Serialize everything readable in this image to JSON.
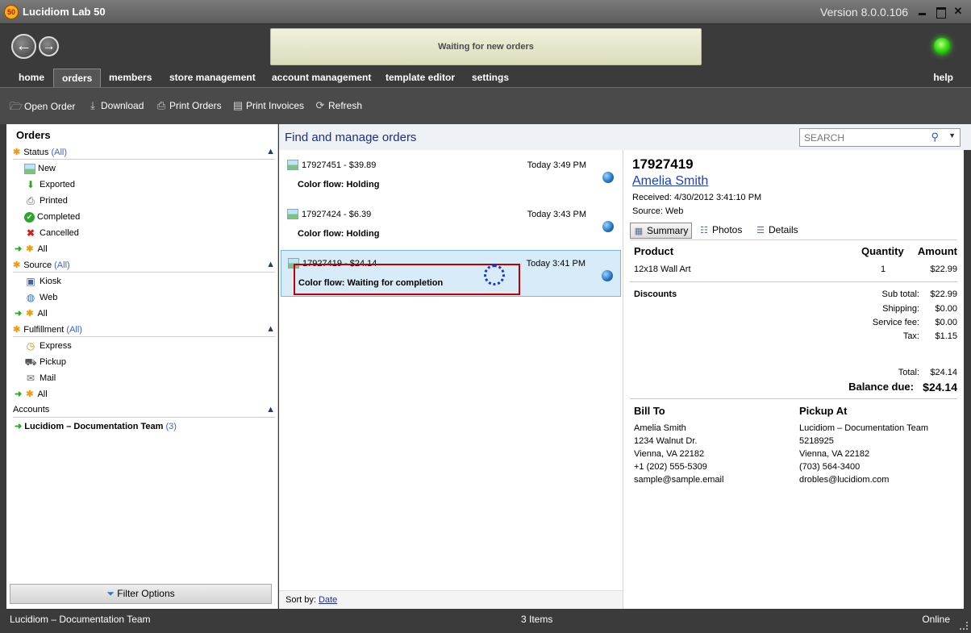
{
  "window": {
    "title": "Lucidiom Lab 50",
    "logo_text": "50",
    "version": "Version 8.0.0.106"
  },
  "header": {
    "status_message": "Waiting for new orders"
  },
  "tabs": [
    "home",
    "orders",
    "members",
    "store management",
    "account management",
    "template editor",
    "settings"
  ],
  "help_tab": "help",
  "toolbar": [
    "Open Order",
    "Download",
    "Print Orders",
    "Print Invoices",
    "Refresh"
  ],
  "left": {
    "title": "Orders",
    "status": {
      "label": "Status",
      "all": "(All)",
      "items": [
        "New",
        "Exported",
        "Printed",
        "Completed",
        "Cancelled"
      ],
      "all_item": "All"
    },
    "source": {
      "label": "Source",
      "all": "(All)",
      "items": [
        "Kiosk",
        "Web"
      ],
      "all_item": "All"
    },
    "fulfillment": {
      "label": "Fulfillment",
      "all": "(All)",
      "items": [
        "Express",
        "Pickup",
        "Mail"
      ],
      "all_item": "All"
    },
    "accounts": {
      "label": "Accounts",
      "name": "Lucidiom – Documentation Team",
      "count": "(3)"
    },
    "filter_button": "Filter Options"
  },
  "center": {
    "title": "Find and manage orders",
    "search_placeholder": "SEARCH",
    "orders": [
      {
        "id": "17927451 - $39.89",
        "time": "Today 3:49 PM",
        "flow": "Color flow: Holding"
      },
      {
        "id": "17927424 - $6.39",
        "time": "Today 3:43 PM",
        "flow": "Color flow: Holding"
      },
      {
        "id": "17927419 - $24.14",
        "time": "Today 3:41 PM",
        "flow": "Color flow: Waiting for completion"
      }
    ],
    "sort_label": "Sort by:",
    "sort_value": "Date"
  },
  "detail": {
    "order_id": "17927419",
    "customer": "Amelia Smith",
    "received": "Received: 4/30/2012 3:41:10 PM",
    "source": "Source: Web",
    "tabs": [
      "Summary",
      "Photos",
      "Details"
    ],
    "headers": {
      "product": "Product",
      "quantity": "Quantity",
      "amount": "Amount"
    },
    "line_item": {
      "product": "12x18 Wall Art",
      "quantity": "1",
      "amount": "$22.99"
    },
    "discounts_label": "Discounts",
    "totals": [
      {
        "label": "Sub total:",
        "value": "$22.99"
      },
      {
        "label": "Shipping:",
        "value": "$0.00"
      },
      {
        "label": "Service fee:",
        "value": "$0.00"
      },
      {
        "label": "Tax:",
        "value": "$1.15"
      },
      {
        "label": "Total:",
        "value": "$24.14"
      }
    ],
    "balance_label": "Balance due:",
    "balance_value": "$24.14",
    "bill_to": {
      "title": "Bill To",
      "lines": [
        "Amelia Smith",
        "1234 Walnut Dr.",
        "Vienna, VA 22182",
        "+1 (202) 555-5309",
        "sample@sample.email"
      ]
    },
    "pickup_at": {
      "title": "Pickup At",
      "lines": [
        "Lucidiom – Documentation Team",
        "5218925",
        "Vienna, VA 22182",
        "(703) 564-3400",
        "drobles@lucidiom.com"
      ]
    }
  },
  "statusbar": {
    "account": "Lucidiom – Documentation Team",
    "count": "3 Items",
    "connection": "Online"
  }
}
